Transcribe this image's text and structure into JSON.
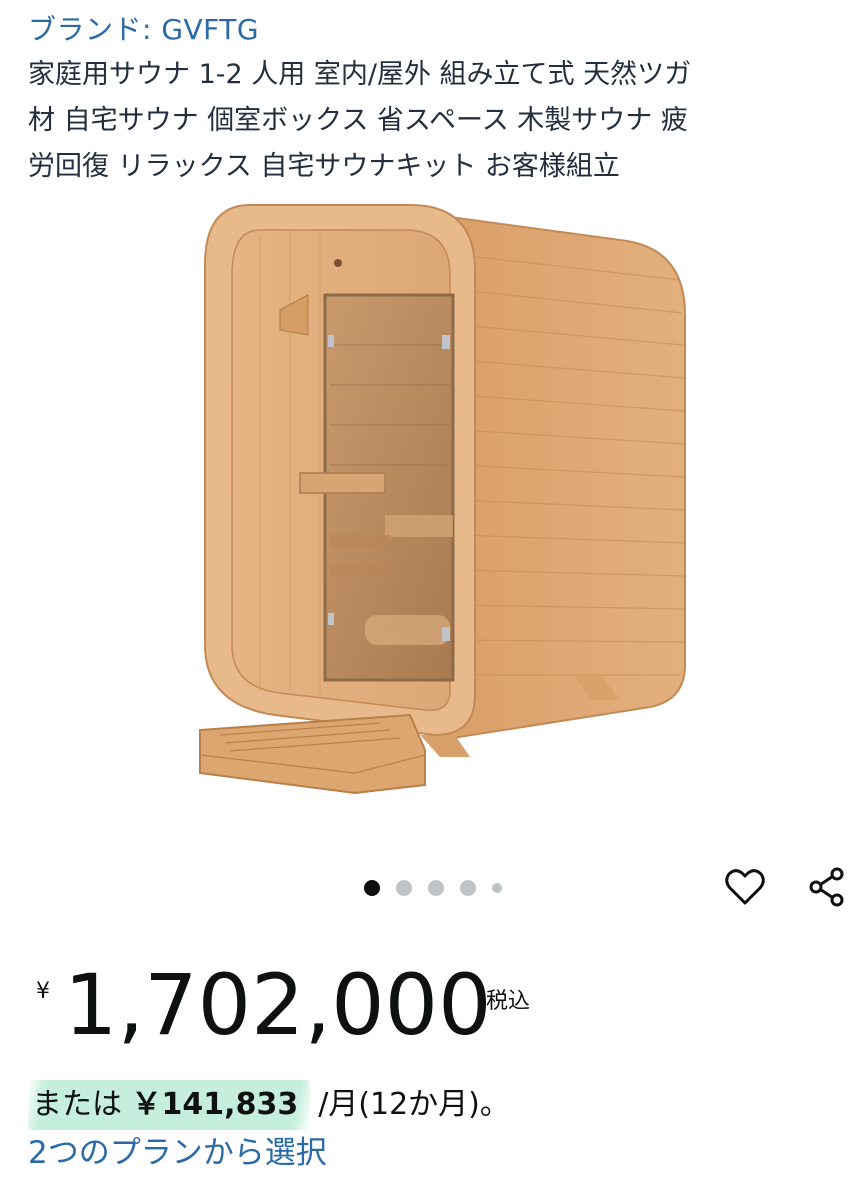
{
  "brand": {
    "text": "ブランド: GVFTG"
  },
  "product": {
    "title_line1": "家庭用サウナ 1-2 人用 室内/屋外 組み立て式 天然ツガ",
    "title_line2": "材 自宅サウナ 個室ボックス 省スペース 木製サウナ 疲",
    "title_line3": "労回復 リラックス 自宅サウナキット お客様組立"
  },
  "carousel": {
    "count": 5,
    "active_index": 0
  },
  "actions": {
    "wishlist_icon": "heart-outline-icon",
    "share_icon": "share-icon"
  },
  "price": {
    "currency_symbol": "¥",
    "amount": "1,702,000",
    "tax_label": "税込"
  },
  "installment": {
    "prefix": "または",
    "amount": "￥141,833",
    "suffix": "/月(12か月)。",
    "plan_link": "2つのプランから選択"
  },
  "colors": {
    "link": "#2a6aa6",
    "highlight": "#c5eedd",
    "wood": "#d9a572"
  }
}
